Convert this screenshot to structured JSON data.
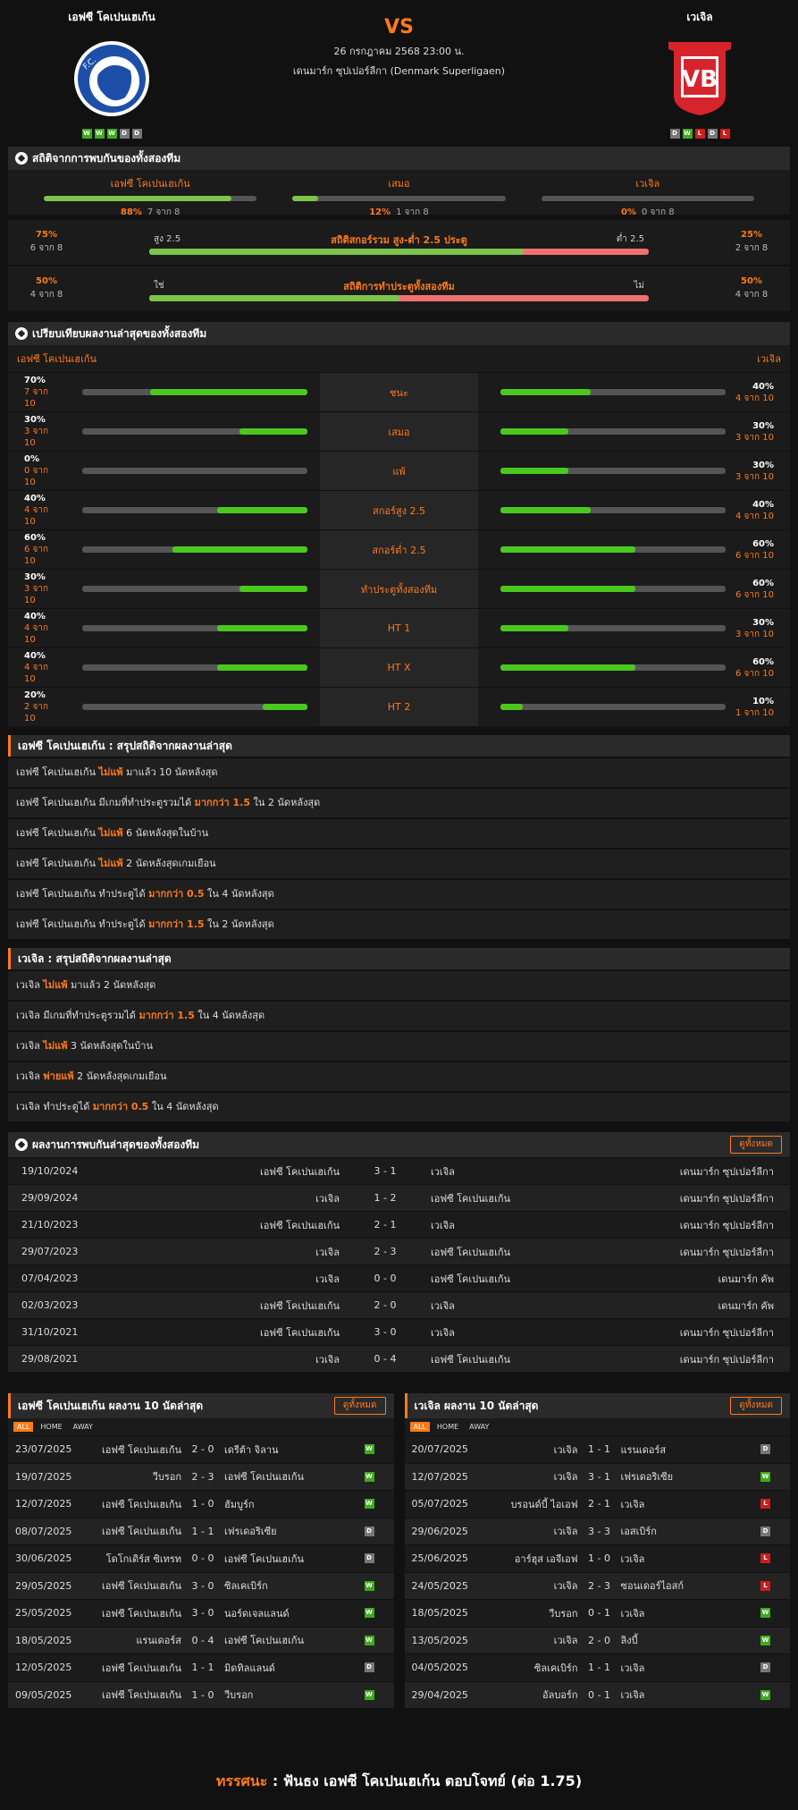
{
  "match": {
    "vs": "VS",
    "date": "26 กรกฎาคม 2568 23:00 น.",
    "league": "เดนมาร์ก ซุปเปอร์ลีกา (Denmark Superligaen)",
    "home": {
      "name": "เอฟซี โคเปนเฮเก้น",
      "form": [
        "W",
        "W",
        "W",
        "D",
        "D"
      ]
    },
    "away": {
      "name": "เวเจิล",
      "form": [
        "D",
        "W",
        "L",
        "D",
        "L"
      ]
    }
  },
  "h2h_stats": {
    "title": "สถิติจากการพบกันของทั้งสองทีม",
    "cols": [
      {
        "label": "เอฟซี โคเปนเฮเก้น",
        "pct": "88%",
        "count": "7 จาก 8",
        "fill": 0.88
      },
      {
        "label": "เสมอ",
        "pct": "12%",
        "count": "1 จาก 8",
        "fill": 0.12
      },
      {
        "label": "เวเจิล",
        "pct": "0%",
        "count": "0 จาก 8",
        "fill": 0
      }
    ],
    "ou": {
      "title": "สถิติสกอร์รวม สูง-ต่ำ 2.5 ประตู",
      "left_pct": "75%",
      "left_count": "6 จาก 8",
      "right_pct": "25%",
      "right_count": "2 จาก 8",
      "left_label": "สูง 2.5",
      "right_label": "ต่ำ 2.5",
      "fill": 0.75
    },
    "btts": {
      "title": "สถิติการทำประตูทั้งสองทีม",
      "left_pct": "50%",
      "left_count": "4 จาก 8",
      "right_pct": "50%",
      "right_count": "4 จาก 8",
      "left_label": "ใช่",
      "right_label": "ไม่",
      "fill": 0.5
    }
  },
  "compare": {
    "title": "เปรียบเทียบผลงานล่าสุดของทั้งสองทีม",
    "home": "เอฟซี โคเปนเฮเก้น",
    "away": "เวเจิล",
    "rows": [
      {
        "label": "ชนะ",
        "hp": "70%",
        "hc": "7 จาก 10",
        "hf": 0.7,
        "ap": "40%",
        "ac": "4 จาก 10",
        "af": 0.4
      },
      {
        "label": "เสมอ",
        "hp": "30%",
        "hc": "3 จาก 10",
        "hf": 0.3,
        "ap": "30%",
        "ac": "3 จาก 10",
        "af": 0.3
      },
      {
        "label": "แพ้",
        "hp": "0%",
        "hc": "0 จาก 10",
        "hf": 0,
        "ap": "30%",
        "ac": "3 จาก 10",
        "af": 0.3
      },
      {
        "label": "สกอร์สูง 2.5",
        "hp": "40%",
        "hc": "4 จาก 10",
        "hf": 0.4,
        "ap": "40%",
        "ac": "4 จาก 10",
        "af": 0.4
      },
      {
        "label": "สกอร์ต่ำ 2.5",
        "hp": "60%",
        "hc": "6 จาก 10",
        "hf": 0.6,
        "ap": "60%",
        "ac": "6 จาก 10",
        "af": 0.6
      },
      {
        "label": "ทำประตูทั้งสองทีม",
        "hp": "30%",
        "hc": "3 จาก 10",
        "hf": 0.3,
        "ap": "60%",
        "ac": "6 จาก 10",
        "af": 0.6
      },
      {
        "label": "HT 1",
        "hp": "40%",
        "hc": "4 จาก 10",
        "hf": 0.4,
        "ap": "30%",
        "ac": "3 จาก 10",
        "af": 0.3
      },
      {
        "label": "HT X",
        "hp": "40%",
        "hc": "4 จาก 10",
        "hf": 0.4,
        "ap": "60%",
        "ac": "6 จาก 10",
        "af": 0.6
      },
      {
        "label": "HT 2",
        "hp": "20%",
        "hc": "2 จาก 10",
        "hf": 0.2,
        "ap": "10%",
        "ac": "1 จาก 10",
        "af": 0.1
      }
    ]
  },
  "home_summary": {
    "title": "เอฟซี โคเปนเฮเก้น : สรุปสถิติจากผลงานล่าสุด",
    "rows": [
      [
        "เอฟซี โคเปนเฮเก้น ",
        "ไม่แพ้",
        " มาแล้ว 10 นัดหลังสุด"
      ],
      [
        "เอฟซี โคเปนเฮเก้น  มีเกมที่ทำประตูรวมได้ ",
        "มากกว่า  1.5",
        " ใน 2 นัดหลังสุด"
      ],
      [
        "เอฟซี โคเปนเฮเก้น ",
        "ไม่แพ้",
        " 6  นัดหลังสุดในบ้าน"
      ],
      [
        "เอฟซี โคเปนเฮเก้น ",
        "ไม่แพ้",
        " 2  นัดหลังสุดเกมเยือน"
      ],
      [
        "เอฟซี โคเปนเฮเก้น  ทำประตูได้ ",
        "มากกว่า  0.5",
        " ใน 4 นัดหลังสุด"
      ],
      [
        "เอฟซี โคเปนเฮเก้น  ทำประตูได้ ",
        "มากกว่า  1.5",
        " ใน 2 นัดหลังสุด"
      ]
    ]
  },
  "away_summary": {
    "title": "เวเจิล : สรุปสถิติจากผลงานล่าสุด",
    "rows": [
      [
        "เวเจิล ",
        "ไม่แพ้",
        " มาแล้ว 2 นัดหลังสุด"
      ],
      [
        "เวเจิล  มีเกมที่ทำประตูรวมได้ ",
        "มากกว่า  1.5",
        " ใน 4 นัดหลังสุด"
      ],
      [
        "เวเจิล ",
        "ไม่แพ้",
        " 3  นัดหลังสุดในบ้าน"
      ],
      [
        "เวเจิล ",
        "พ่ายแพ้",
        " 2  นัดหลังสุดเกมเยือน"
      ],
      [
        "เวเจิล  ทำประตูได้ ",
        "มากกว่า  0.5",
        " ใน 4 นัดหลังสุด"
      ]
    ]
  },
  "meetings": {
    "title": "ผลงานการพบกันล่าสุดของทั้งสองทีม",
    "button": "ดูทั้งหมด",
    "rows": [
      [
        "19/10/2024",
        "เอฟซี โคเปนเฮเก้น",
        "3 - 1",
        "เวเจิล",
        "เดนมาร์ก ซุปเปอร์ลีกา"
      ],
      [
        "29/09/2024",
        "เวเจิล",
        "1 - 2",
        "เอฟซี โคเปนเฮเก้น",
        "เดนมาร์ก ซุปเปอร์ลีกา"
      ],
      [
        "21/10/2023",
        "เอฟซี โคเปนเฮเก้น",
        "2 - 1",
        "เวเจิล",
        "เดนมาร์ก ซุปเปอร์ลีกา"
      ],
      [
        "29/07/2023",
        "เวเจิล",
        "2 - 3",
        "เอฟซี โคเปนเฮเก้น",
        "เดนมาร์ก ซุปเปอร์ลีกา"
      ],
      [
        "07/04/2023",
        "เวเจิล",
        "0 - 0",
        "เอฟซี โคเปนเฮเก้น",
        "เดนมาร์ก คัพ"
      ],
      [
        "02/03/2023",
        "เอฟซี โคเปนเฮเก้น",
        "2 - 0",
        "เวเจิล",
        "เดนมาร์ก คัพ"
      ],
      [
        "31/10/2021",
        "เอฟซี โคเปนเฮเก้น",
        "3 - 0",
        "เวเจิล",
        "เดนมาร์ก ซุปเปอร์ลีกา"
      ],
      [
        "29/08/2021",
        "เวเจิล",
        "0 - 4",
        "เอฟซี โคเปนเฮเก้น",
        "เดนมาร์ก ซุปเปอร์ลีกา"
      ]
    ]
  },
  "home_last10": {
    "title": "เอฟซี โคเปนเฮเก้น ผลงาน 10 นัดล่าสุด",
    "button": "ดูทั้งหมด",
    "filters": [
      "ALL",
      "HOME",
      "AWAY"
    ],
    "rows": [
      [
        "23/07/2025",
        "เอฟซี โคเปนเฮเก้น",
        "2 - 0",
        "เดรีต้า จิลาน",
        "W"
      ],
      [
        "19/07/2025",
        "วีบรอก",
        "2 - 3",
        "เอฟซี โคเปนเฮเก้น",
        "W"
      ],
      [
        "12/07/2025",
        "เอฟซี โคเปนเฮเก้น",
        "1 - 0",
        "ฮัมบูร์ก",
        "W"
      ],
      [
        "08/07/2025",
        "เอฟซี โคเปนเฮเก้น",
        "1 - 1",
        "เฟรเดอริเซีย",
        "D"
      ],
      [
        "30/06/2025",
        "โดโกเดิร์ส ซิเทรท",
        "0 - 0",
        "เอฟซี โคเปนเฮเก้น",
        "D"
      ],
      [
        "29/05/2025",
        "เอฟซี โคเปนเฮเก้น",
        "3 - 0",
        "ซิลเคเบิร์ก",
        "W"
      ],
      [
        "25/05/2025",
        "เอฟซี โคเปนเฮเก้น",
        "3 - 0",
        "นอร์ดเจลแลนด์",
        "W"
      ],
      [
        "18/05/2025",
        "แรนเดอร์ส",
        "0 - 4",
        "เอฟซี โคเปนเฮเก้น",
        "W"
      ],
      [
        "12/05/2025",
        "เอฟซี โคเปนเฮเก้น",
        "1 - 1",
        "มิดทิลแลนด์",
        "D"
      ],
      [
        "09/05/2025",
        "เอฟซี โคเปนเฮเก้น",
        "1 - 0",
        "วีบรอก",
        "W"
      ]
    ]
  },
  "away_last10": {
    "title": "เวเจิล ผลงาน 10 นัดล่าสุด",
    "button": "ดูทั้งหมด",
    "filters": [
      "ALL",
      "HOME",
      "AWAY"
    ],
    "rows": [
      [
        "20/07/2025",
        "เวเจิล",
        "1 - 1",
        "แรนเดอร์ส",
        "D"
      ],
      [
        "12/07/2025",
        "เวเจิล",
        "3 - 1",
        "เฟรเดอริเซีย",
        "W"
      ],
      [
        "05/07/2025",
        "บรอนด์บี้ ไอเอฟ",
        "2 - 1",
        "เวเจิล",
        "L"
      ],
      [
        "29/06/2025",
        "เวเจิล",
        "3 - 3",
        "เอสเบิร์ก",
        "D"
      ],
      [
        "25/06/2025",
        "อาร์ฮุส เอจีเอฟ",
        "1 - 0",
        "เวเจิล",
        "L"
      ],
      [
        "24/05/2025",
        "เวเจิล",
        "2 - 3",
        "ซอนเดอร์ไอสก์",
        "L"
      ],
      [
        "18/05/2025",
        "วีบรอก",
        "0 - 1",
        "เวเจิล",
        "W"
      ],
      [
        "13/05/2025",
        "เวเจิล",
        "2 - 0",
        "ลิงบี้",
        "W"
      ],
      [
        "04/05/2025",
        "ซิลเคเบิร์ก",
        "1 - 1",
        "เวเจิล",
        "D"
      ],
      [
        "29/04/2025",
        "อัลบอร์ก",
        "0 - 1",
        "เวเจิล",
        "W"
      ]
    ]
  },
  "verdict": {
    "label": "ทรรศนะ",
    "sep": " : ",
    "text": " ฟันธง เอฟซี โคเปนเฮเก้น ตอบโจทย์ (ต่อ 1.75)"
  },
  "colors": {
    "accent": "#ff7a1a",
    "win": "#3cac1a",
    "draw": "#777777",
    "loss": "#d01c1c"
  },
  "icons": {
    "crest_home": "fc-kobenhavn-crest",
    "crest_away": "vejle-crest",
    "section": "soccer-ball-icon"
  }
}
